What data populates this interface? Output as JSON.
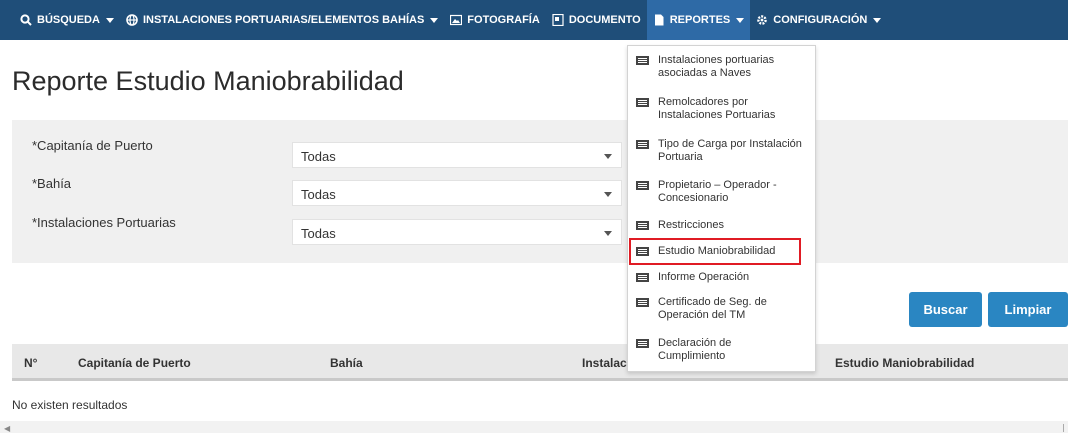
{
  "nav": {
    "items": [
      {
        "label": "BÚSQUEDA",
        "icon": "search-icon"
      },
      {
        "label": "INSTALACIONES PORTUARIAS/ELEMENTOS BAHÍAS",
        "icon": "globe-icon"
      },
      {
        "label": "FOTOGRAFÍA",
        "icon": "image-icon"
      },
      {
        "label": "DOCUMENTO",
        "icon": "document-icon"
      },
      {
        "label": "REPORTES",
        "icon": "file-icon"
      },
      {
        "label": "CONFIGURACIÓN",
        "icon": "gear-icon"
      }
    ]
  },
  "page": {
    "title": "Reporte Estudio Maniobrabilidad"
  },
  "form": {
    "fields": [
      {
        "label": "*Capitanía de Puerto",
        "value": "Todas"
      },
      {
        "label": "*Bahía",
        "value": "Todas"
      },
      {
        "label": "*Instalaciones Portuarias",
        "value": "Todas"
      }
    ]
  },
  "buttons": {
    "search": "Buscar",
    "clear": "Limpiar"
  },
  "table": {
    "headers": [
      "N°",
      "Capitanía de Puerto",
      "Bahía",
      "Instalac",
      "Estudio Maniobrabilidad"
    ],
    "empty_text": "No existen resultados"
  },
  "reportes_menu": {
    "items": [
      {
        "line1": "Instalaciones portuarias",
        "line2": "asociadas a Naves"
      },
      {
        "line1": "Remolcadores por",
        "line2": "Instalaciones Portuarias"
      },
      {
        "line1": "Tipo de Carga por Instalación",
        "line2": "Portuaria"
      },
      {
        "line1": "Propietario – Operador -",
        "line2": "Concesionario"
      },
      {
        "line1": "Restricciones",
        "line2": ""
      },
      {
        "line1": "Estudio Maniobrabilidad",
        "line2": ""
      },
      {
        "line1": "Informe Operación",
        "line2": ""
      },
      {
        "line1": "Certificado de Seg. de",
        "line2": "Operación del TM"
      },
      {
        "line1": "Declaración de",
        "line2": "Cumplimiento"
      }
    ],
    "highlighted_index": 5
  },
  "colors": {
    "nav_bg": "#1f4e79",
    "nav_active": "#2e6aa6",
    "button": "#2a86c2",
    "highlight": "#e01b24"
  }
}
